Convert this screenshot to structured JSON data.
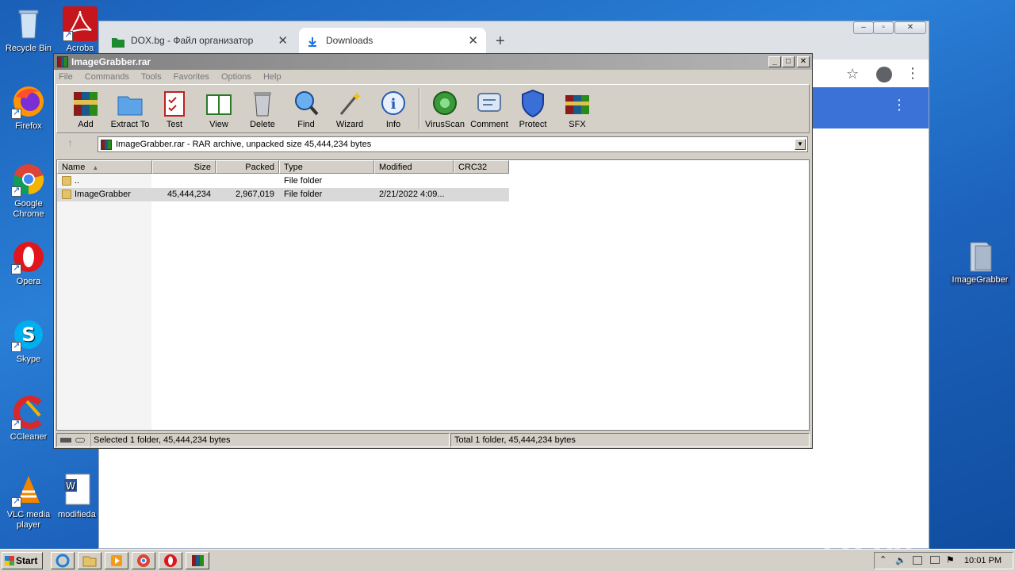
{
  "desktop": {
    "icons": [
      {
        "label": "Recycle Bin"
      },
      {
        "label": "Acroba"
      },
      {
        "label": "Firefox"
      },
      {
        "label": "Google Chrome"
      },
      {
        "label": "Opera"
      },
      {
        "label": "Skype"
      },
      {
        "label": "CCleaner"
      },
      {
        "label": "VLC media player"
      },
      {
        "label": "modifieda"
      },
      {
        "label": "ImageGrabber"
      }
    ]
  },
  "chrome": {
    "tabs": [
      {
        "label": "DOX.bg - Файл организатор"
      },
      {
        "label": "Downloads"
      }
    ]
  },
  "winrar": {
    "title": "ImageGrabber.rar",
    "menu": [
      "File",
      "Commands",
      "Tools",
      "Favorites",
      "Options",
      "Help"
    ],
    "toolbar": [
      "Add",
      "Extract To",
      "Test",
      "View",
      "Delete",
      "Find",
      "Wizard",
      "Info",
      "VirusScan",
      "Comment",
      "Protect",
      "SFX"
    ],
    "address": "ImageGrabber.rar - RAR archive, unpacked size 45,444,234 bytes",
    "columns": [
      "Name",
      "Size",
      "Packed",
      "Type",
      "Modified",
      "CRC32"
    ],
    "rows": [
      {
        "name": "..",
        "size": "",
        "packed": "",
        "type": "File folder",
        "modified": ""
      },
      {
        "name": "ImageGrabber",
        "size": "45,444,234",
        "packed": "2,967,019",
        "type": "File folder",
        "modified": "2/21/2022 4:09..."
      }
    ],
    "status_left": "Selected 1 folder, 45,444,234 bytes",
    "status_right": "Total 1 folder, 45,444,234 bytes"
  },
  "taskbar": {
    "start": "Start",
    "clock": "10:01 PM"
  },
  "watermark": "ANY RUN"
}
